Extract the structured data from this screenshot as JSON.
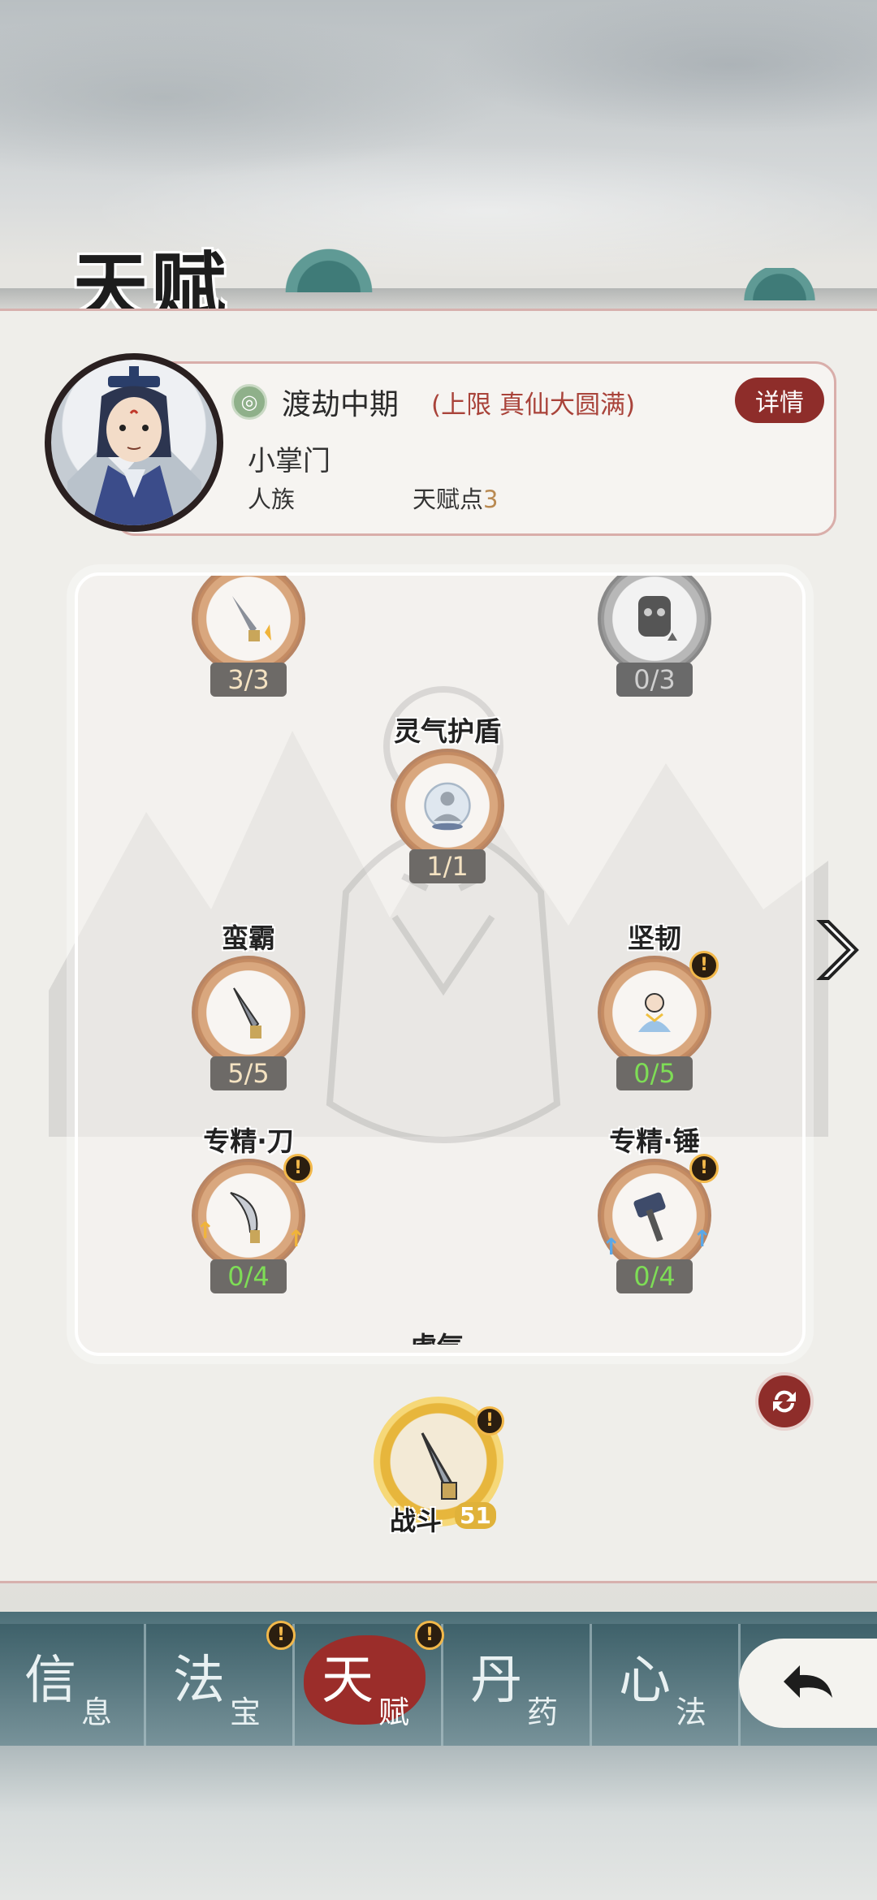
{
  "header": {
    "title": "天赋"
  },
  "profile": {
    "realm": "渡劫中期",
    "realm_limit": "(上限 真仙大圆满)",
    "detail_label": "详情",
    "player_title": "小掌门",
    "race": "人族",
    "talent_points_label": "天赋点",
    "talent_points_value": "3"
  },
  "talents": {
    "top_left": {
      "count": "3/3"
    },
    "top_right": {
      "count": "0/3"
    },
    "spirit_shield": {
      "name": "灵气护盾",
      "count": "1/1"
    },
    "brute": {
      "name": "蛮霸",
      "count": "5/5"
    },
    "tough": {
      "name": "坚韧",
      "count": "0/5"
    },
    "blade_mastery": {
      "name": "专精·刀",
      "count": "0/4"
    },
    "hammer_mastery": {
      "name": "专精·锤",
      "count": "0/4"
    },
    "next_partial": "虎气"
  },
  "battle": {
    "label": "战斗",
    "level": "51"
  },
  "nav": {
    "items": [
      {
        "big": "信",
        "small": "息"
      },
      {
        "big": "法",
        "small": "宝"
      },
      {
        "big": "天",
        "small": "赋"
      },
      {
        "big": "丹",
        "small": "药"
      },
      {
        "big": "心",
        "small": "法"
      }
    ],
    "active_index": 2
  },
  "colors": {
    "accent_red": "#8e2d2a",
    "count_green": "#7edd56",
    "alert_gold": "#f2b84a"
  },
  "icons": [
    "realm-icon",
    "sword-icon",
    "demon-mask-icon",
    "meditating-figure-icon",
    "blade-icon",
    "hammer-icon",
    "chevron-right-icon",
    "refresh-icon",
    "back-arrow-icon",
    "alert-icon"
  ]
}
